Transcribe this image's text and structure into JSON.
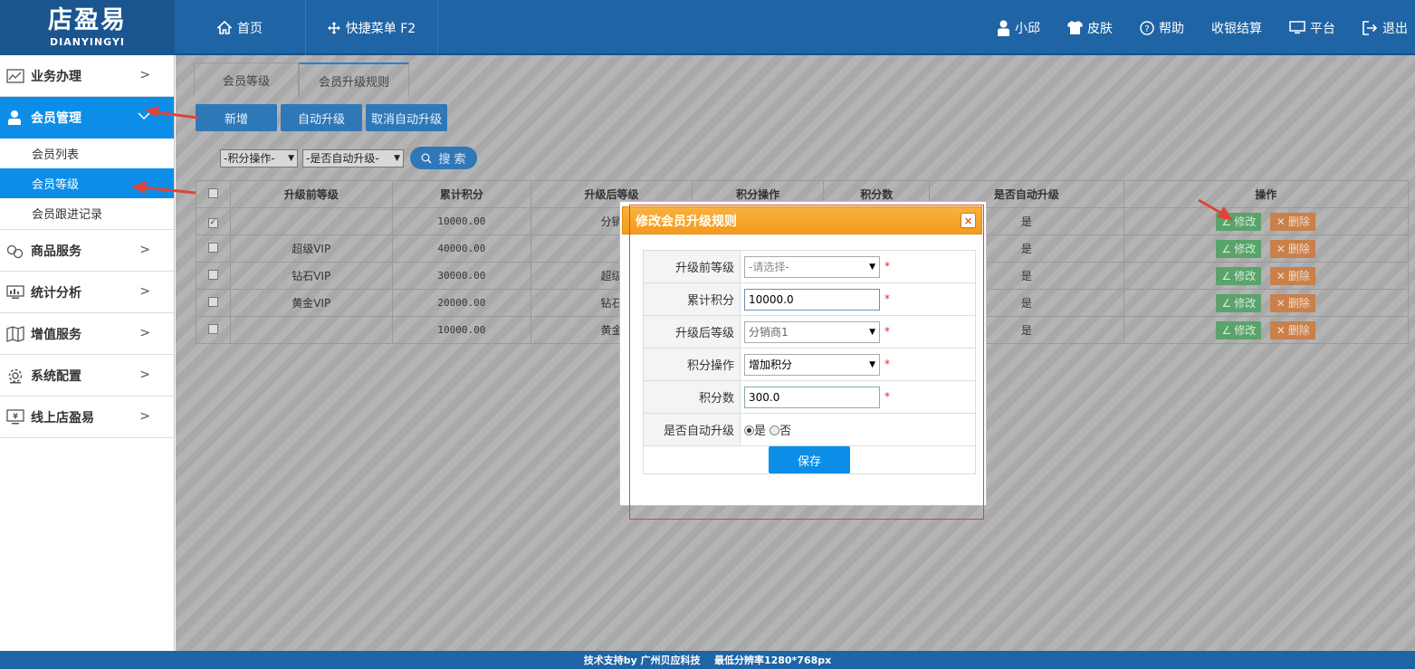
{
  "logo": {
    "cn": "店盈易",
    "en": "DIANYINGYI"
  },
  "topnav": {
    "home": "首页",
    "quick_menu": "快捷菜单 F2",
    "user": "小邱",
    "skin": "皮肤",
    "help": "帮助",
    "checkout": "收银结算",
    "platform": "平台",
    "logout": "退出"
  },
  "sidebar": {
    "items": [
      {
        "label": "业务办理",
        "icon": "chart-icon"
      },
      {
        "label": "会员管理",
        "icon": "user-icon"
      },
      {
        "label": "商品服务",
        "icon": "goods-icon"
      },
      {
        "label": "统计分析",
        "icon": "stats-icon"
      },
      {
        "label": "增值服务",
        "icon": "map-icon"
      },
      {
        "label": "系统配置",
        "icon": "gear-icon"
      },
      {
        "label": "线上店盈易",
        "icon": "monitor-yen-icon"
      }
    ],
    "sub": [
      "会员列表",
      "会员等级",
      "会员跟进记录"
    ]
  },
  "tabs": [
    "会员等级",
    "会员升级规则"
  ],
  "toolbar": {
    "add": "新增",
    "auto": "自动升级",
    "cancel_auto": "取消自动升级"
  },
  "filters": {
    "points_op": "-积分操作-",
    "is_auto": "-是否自动升级-",
    "search": "搜 索"
  },
  "table": {
    "headers": [
      "升级前等级",
      "累计积分",
      "升级后等级",
      "积分操作",
      "积分数",
      "是否自动升级",
      "操作"
    ],
    "rows": [
      {
        "checked": true,
        "before": "",
        "points": "10000.00",
        "after": "分销",
        "auto": "是"
      },
      {
        "checked": false,
        "before": "超级VIP",
        "points": "40000.00",
        "after": "",
        "auto": "是"
      },
      {
        "checked": false,
        "before": "钻石VIP",
        "points": "30000.00",
        "after": "超级",
        "auto": "是"
      },
      {
        "checked": false,
        "before": "黄金VIP",
        "points": "20000.00",
        "after": "钻石",
        "auto": "是"
      },
      {
        "checked": false,
        "before": "",
        "points": "10000.00",
        "after": "黄金",
        "auto": "是"
      }
    ],
    "edit_label": "修改",
    "delete_label": "删除"
  },
  "modal": {
    "title": "修改会员升级规则",
    "close": "×",
    "fields": {
      "before_label": "升级前等级",
      "before_value": "-请选择-",
      "points_label": "累计积分",
      "points_value": "10000.0",
      "after_label": "升级后等级",
      "after_value": "分销商1",
      "op_label": "积分操作",
      "op_value": "增加积分",
      "num_label": "积分数",
      "num_value": "300.0",
      "auto_label": "是否自动升级",
      "auto_yes": "是",
      "auto_no": "否"
    },
    "required": "*",
    "save": "保存"
  },
  "footer": "技术支持by 广州贝应科技    最低分辨率1280*768px",
  "colors": {
    "header": "#1f64a5",
    "active": "#0c8ee8",
    "modal_head": "#f7a52a",
    "edit": "#5aa36b",
    "delete": "#c9804a"
  }
}
